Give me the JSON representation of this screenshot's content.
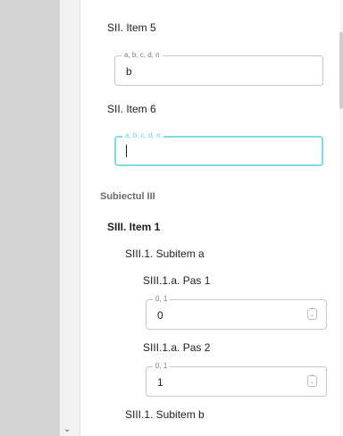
{
  "nav": {
    "collapse_icon": "chevron-down-icon"
  },
  "items": [
    {
      "label": "SII. Item 5",
      "field_hint": "a, b, c, d, n",
      "value": "b"
    },
    {
      "label": "SII. Item 6",
      "field_hint": "a, b, c, d, n",
      "value": ""
    }
  ],
  "section": {
    "title": "Subiectul III",
    "item": "SIII. Item 1",
    "subitem_a": "SIII.1. Subitem a",
    "step1": {
      "label": "SIII.1.a. Pas 1",
      "field_hint": "0, 1",
      "value": "0"
    },
    "step2": {
      "label": "SIII.1.a. Pas 2",
      "field_hint": "0, 1",
      "value": "1"
    },
    "subitem_b": "SIII.1. Subitem b"
  },
  "colors": {
    "focus": "#7fdbe5",
    "sidebar": "#d4d4d4"
  }
}
